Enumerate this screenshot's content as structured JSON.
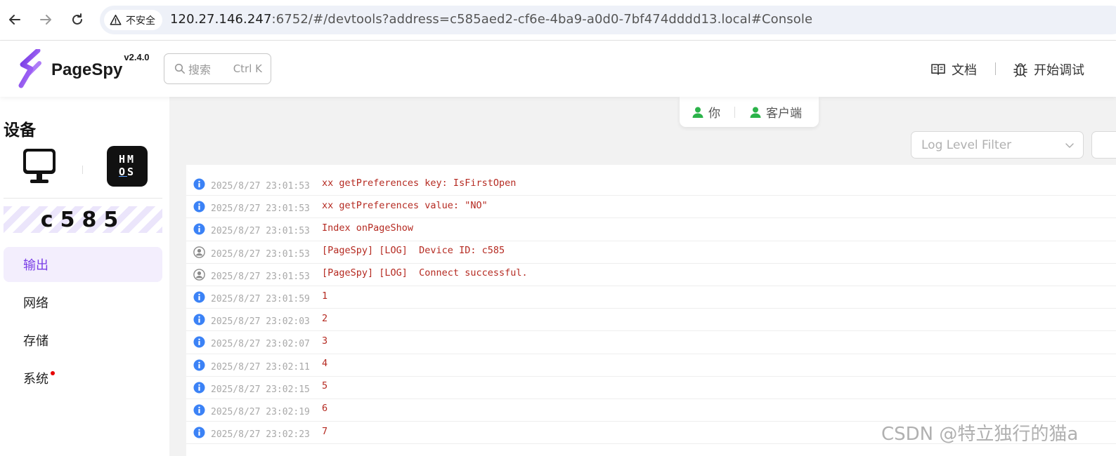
{
  "browser": {
    "security_label": "不安全",
    "url_host": "120.27.146.247",
    "url_rest": ":6752/#/devtools?address=c585aed2-cf6e-4ba9-a0d0-7bf474dddd13.local#Console"
  },
  "header": {
    "brand": "PageSpy",
    "version": "v2.4.0",
    "search_placeholder": "搜索",
    "search_shortcut": "Ctrl K",
    "docs_label": "文档",
    "debug_label": "开始调试"
  },
  "sidebar": {
    "title": "设备",
    "os_badge": {
      "line1": "HM",
      "line2_a": "O",
      "line2_b": "S"
    },
    "device_id": "c585",
    "menu": [
      {
        "label": "输出",
        "active": true
      },
      {
        "label": "网络",
        "active": false
      },
      {
        "label": "存储",
        "active": false
      },
      {
        "label": "系统",
        "active": false,
        "badge": "red-dot"
      }
    ]
  },
  "connection": {
    "you_label": "你",
    "client_label": "客户端",
    "status_color": "#2bb34a"
  },
  "filter": {
    "placeholder": "Log Level Filter"
  },
  "logs": [
    {
      "icon": "info-icon",
      "time": "2025/8/27 23:01:53",
      "msg": "xx getPreferences key: IsFirstOpen"
    },
    {
      "icon": "info-icon",
      "time": "2025/8/27 23:01:53",
      "msg": "xx getPreferences value: \"NO\""
    },
    {
      "icon": "info-icon",
      "time": "2025/8/27 23:01:53",
      "msg": "Index onPageShow"
    },
    {
      "icon": "user-icon",
      "time": "2025/8/27 23:01:53",
      "msg": "[PageSpy] [LOG]  Device ID: c585"
    },
    {
      "icon": "user-icon",
      "time": "2025/8/27 23:01:53",
      "msg": "[PageSpy] [LOG]  Connect successful."
    },
    {
      "icon": "info-icon",
      "time": "2025/8/27 23:01:59",
      "msg": "1"
    },
    {
      "icon": "info-icon",
      "time": "2025/8/27 23:02:03",
      "msg": "2"
    },
    {
      "icon": "info-icon",
      "time": "2025/8/27 23:02:07",
      "msg": "3"
    },
    {
      "icon": "info-icon",
      "time": "2025/8/27 23:02:11",
      "msg": "4"
    },
    {
      "icon": "info-icon",
      "time": "2025/8/27 23:02:15",
      "msg": "5"
    },
    {
      "icon": "info-icon",
      "time": "2025/8/27 23:02:19",
      "msg": "6"
    },
    {
      "icon": "info-icon",
      "time": "2025/8/27 23:02:23",
      "msg": "7"
    }
  ],
  "colors": {
    "accent": "#7a3fe6",
    "info": "#3b82f6",
    "log_text": "#b52a21"
  },
  "watermark": "CSDN @特立独行的猫a"
}
